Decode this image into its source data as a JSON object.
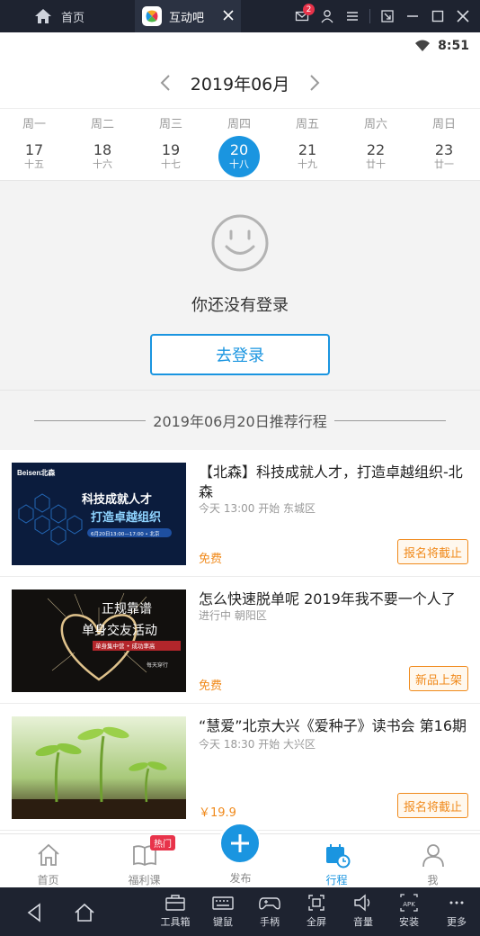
{
  "emulator": {
    "home_label": "首页",
    "tab_label": "互动吧",
    "mail_badge": "2",
    "toolbar": [
      {
        "label": "工具箱",
        "icon": "toolbox-icon"
      },
      {
        "label": "键鼠",
        "icon": "keyboard-icon"
      },
      {
        "label": "手柄",
        "icon": "gamepad-icon"
      },
      {
        "label": "全屏",
        "icon": "fullscreen-icon"
      },
      {
        "label": "音量",
        "icon": "volume-icon"
      },
      {
        "label": "安装",
        "icon": "apk-install-icon"
      },
      {
        "label": "更多",
        "icon": "more-icon"
      }
    ]
  },
  "status_bar": {
    "time": "8:51"
  },
  "calendar": {
    "month": "2019年06月",
    "days": [
      {
        "weekday": "周一",
        "date": "17",
        "lunar": "十五"
      },
      {
        "weekday": "周二",
        "date": "18",
        "lunar": "十六"
      },
      {
        "weekday": "周三",
        "date": "19",
        "lunar": "十七"
      },
      {
        "weekday": "周四",
        "date": "20",
        "lunar": "十八"
      },
      {
        "weekday": "周五",
        "date": "21",
        "lunar": "十九"
      },
      {
        "weekday": "周六",
        "date": "22",
        "lunar": "廿十"
      },
      {
        "weekday": "周日",
        "date": "23",
        "lunar": "廿一"
      }
    ],
    "selected_index": 3
  },
  "login": {
    "message": "你还没有登录",
    "button": "去登录"
  },
  "recommend": {
    "title": "2019年06月20日推荐行程"
  },
  "events": [
    {
      "title": "【北森】科技成就人才，打造卓越组织-北森",
      "meta": "今天 13:00 开始  东城区",
      "price": "免费",
      "tag": "报名将截止",
      "image": {
        "brand": "Beisen北森",
        "line1": "科技成就人才",
        "line2": "打造卓越组织",
        "date_strip": "6月20日13:00—17:00 • 北京"
      }
    },
    {
      "title": "怎么快速脱单呢 2019年我不要一个人了",
      "meta": "进行中  朝阳区",
      "price": "免费",
      "tag": "新品上架",
      "image": {
        "line1": "正规靠谱",
        "line2": "单身交友活动",
        "strip": "单身集中营 • 成功率高",
        "brand": "每天穿行"
      }
    },
    {
      "title": "“慧爱”北京大兴《爱种子》读书会 第16期",
      "meta": "今天 18:30 开始  大兴区",
      "price": "￥19.9",
      "tag": "报名将截止"
    }
  ],
  "bottom_nav": [
    {
      "label": "首页",
      "icon": "home-icon"
    },
    {
      "label": "福利课",
      "icon": "book-icon",
      "badge": "热门"
    },
    {
      "label": "发布",
      "icon": "plus-icon"
    },
    {
      "label": "行程",
      "icon": "calendar-clock-icon",
      "active": true
    },
    {
      "label": "我",
      "icon": "person-icon"
    }
  ],
  "colors": {
    "accent": "#1a95e0",
    "orange": "#f08a1c",
    "emulator_bg": "#1e2330"
  }
}
